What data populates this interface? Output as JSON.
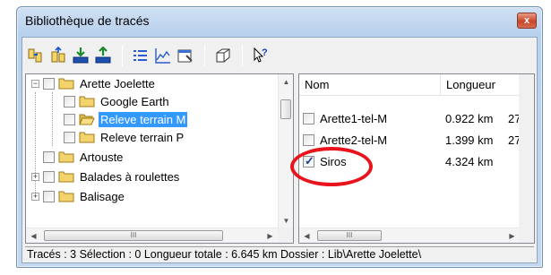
{
  "window": {
    "title": "Bibliothèque de tracés",
    "close_label": "x"
  },
  "toolbar": {
    "buttons": [
      {
        "icon": "copy-tracks-icon"
      },
      {
        "icon": "new-folder-icon"
      },
      {
        "icon": "import-icon"
      },
      {
        "icon": "export-icon"
      },
      {
        "icon": "list-view-icon"
      },
      {
        "icon": "profile-chart-icon"
      },
      {
        "icon": "properties-icon"
      },
      {
        "icon": "3d-view-icon"
      },
      {
        "icon": "context-help-icon"
      }
    ]
  },
  "tree": {
    "items": [
      {
        "label": "Arette Joelette",
        "level": 0,
        "expander": "−"
      },
      {
        "label": "Google Earth",
        "level": 1
      },
      {
        "label": "Releve terrain M",
        "level": 1,
        "selected": true
      },
      {
        "label": "Releve terrain P",
        "level": 1
      },
      {
        "label": "Artouste",
        "level": 0
      },
      {
        "label": "Balades à roulettes",
        "level": 0,
        "expander": "+"
      },
      {
        "label": "Balisage",
        "level": 0,
        "expander": "+"
      }
    ],
    "hscroll_thumb": "III"
  },
  "list": {
    "columns": [
      "Nom",
      "Longueur"
    ],
    "rows": [
      {
        "name": "Arette1-tel-M",
        "length": "0.922 km",
        "extra": "27",
        "checked": false
      },
      {
        "name": "Arette2-tel-M",
        "length": "1.399 km",
        "extra": "27",
        "checked": false
      },
      {
        "name": "Siros",
        "length": "4.324 km",
        "extra": "",
        "checked": true
      }
    ],
    "hscroll_thumb": "III"
  },
  "status": {
    "text": "Tracés : 3 Sélection : 0 Longueur totale : 6.645 km Dossier : Lib\\Arette Joelette\\"
  },
  "colors": {
    "selection": "#3399ff",
    "highlight_ring": "#e8131b"
  }
}
